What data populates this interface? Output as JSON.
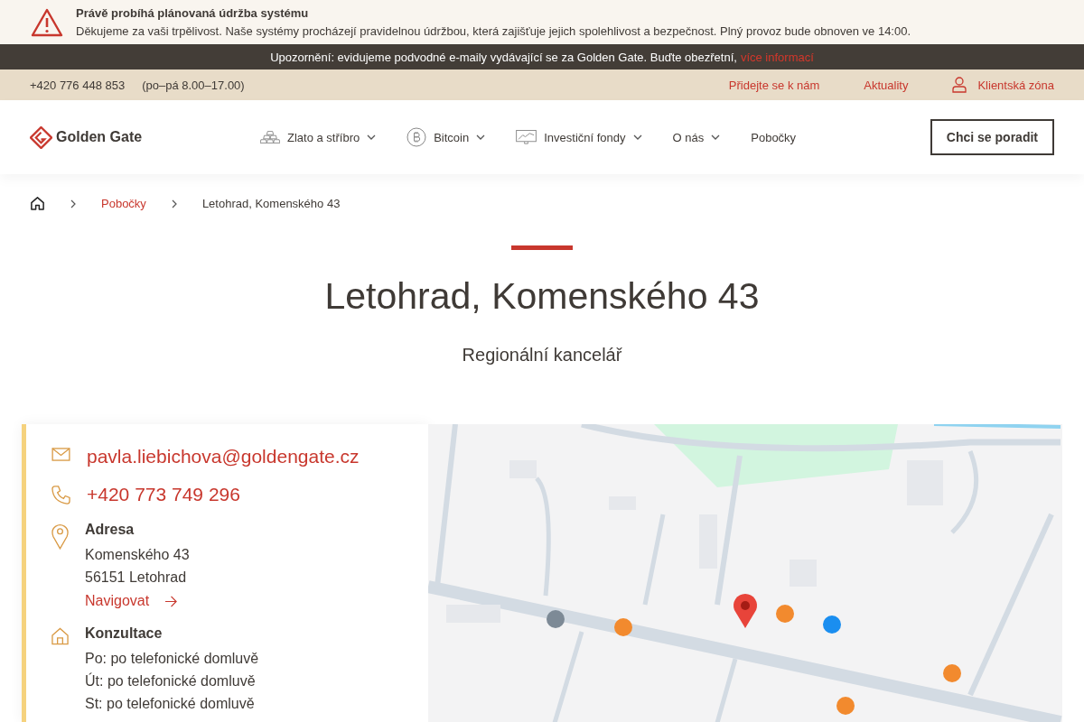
{
  "maintenance": {
    "title": "Právě probíhá plánovaná údržba systému",
    "text": "Děkujeme za vaši trpělivost. Naše systémy procházejí pravidelnou údržbou, která zajišťuje jejich spolehlivost a bezpečnost. Plný provoz bude obnoven ve 14:00."
  },
  "warning": {
    "text": "Upozornění: evidujeme podvodné e-maily vydávající se za Golden Gate. Buďte obezřetní,",
    "link": "více informací"
  },
  "topbar": {
    "phone": "+420 776 448 853",
    "hours": "(po–pá 8.00–17.00)",
    "links": [
      "Přidejte se k nám",
      "Aktuality"
    ],
    "client_zone": "Klientská zóna"
  },
  "header": {
    "logo": "Golden Gate",
    "nav": [
      {
        "label": "Zlato a stříbro",
        "kind": "bars",
        "dropdown": true
      },
      {
        "label": "Bitcoin",
        "kind": "coin",
        "dropdown": true
      },
      {
        "label": "Investiční fondy",
        "kind": "chart",
        "dropdown": true
      },
      {
        "label": "O nás",
        "kind": "plain",
        "dropdown": true
      },
      {
        "label": "Pobočky",
        "kind": "plain",
        "dropdown": false
      }
    ],
    "cta": "Chci se poradit"
  },
  "breadcrumb": [
    "Pobočky",
    "Letohrad, Komenského 43"
  ],
  "page": {
    "title": "Letohrad, Komenského 43",
    "subtitle": "Regionální kancelář"
  },
  "contact": [
    {
      "kind": "email",
      "value": "pavla.liebichova@goldengate.cz"
    },
    {
      "kind": "phone",
      "value": "+420 773 749 296"
    },
    {
      "kind": "address",
      "heading": "Adresa",
      "lines": [
        "Komenského 43",
        "56151 Letohrad"
      ],
      "link": "Navigovat"
    },
    {
      "kind": "hours",
      "heading": "Konzultace",
      "lines": [
        "Po: po telefonické domluvě",
        "Út: po telefonické domluvě",
        "St: po telefonické domluvě"
      ]
    }
  ]
}
